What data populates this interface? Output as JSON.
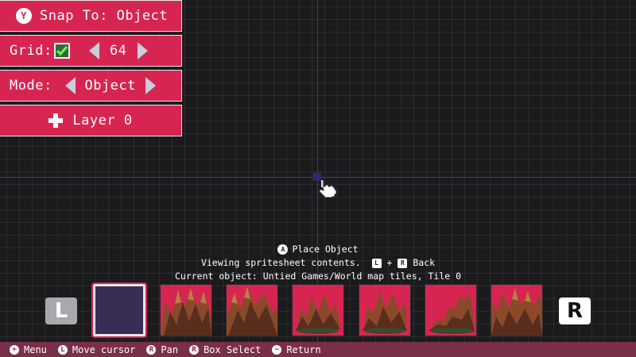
{
  "toolbar": {
    "snap_button_glyph": "Y",
    "snap_label": "Snap To: Object",
    "grid_label": "Grid:",
    "grid_checked": true,
    "grid_size": "64",
    "mode_label": "Mode:",
    "mode_value": "Object",
    "layer_label": "Layer 0"
  },
  "info": {
    "place_glyph": "A",
    "place_label": "Place Object",
    "viewing_text": "Viewing spritesheet contents.",
    "l_glyph": "L",
    "plus": "+",
    "r_glyph": "R",
    "back_label": "Back",
    "current_object": "Current object: Untied Games/World map tiles, Tile 0"
  },
  "tile_strip": {
    "left_shoulder": "L",
    "right_shoulder": "R",
    "tile_count": 7,
    "selected_index": 0
  },
  "bottom_bar": [
    {
      "icon": "plus-icon",
      "glyph": "+",
      "label": "Menu"
    },
    {
      "icon": "left-stick-icon",
      "glyph": "L",
      "label": "Move cursor"
    },
    {
      "icon": "right-stick-icon",
      "glyph": "R",
      "label": "Pan"
    },
    {
      "icon": "right-stick-click-icon",
      "glyph": "R",
      "label": "Box Select"
    },
    {
      "icon": "minus-icon",
      "glyph": "−",
      "label": "Return"
    }
  ],
  "colors": {
    "accent": "#d72552",
    "bottom_bar": "#7a2f48",
    "axis": "#3b3a8a",
    "background": "#1b1b1e"
  }
}
